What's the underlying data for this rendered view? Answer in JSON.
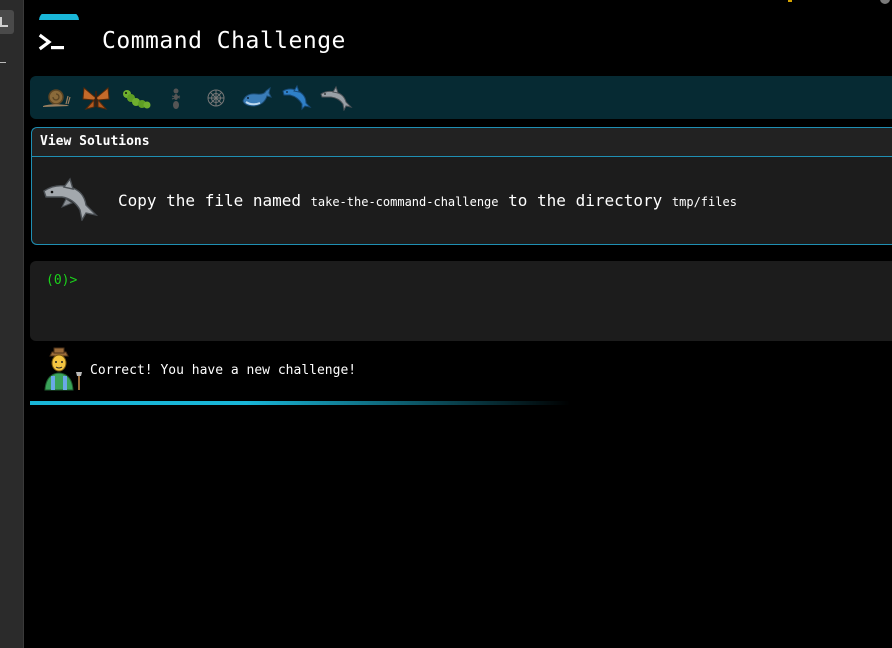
{
  "app": {
    "title": "Command Challenge"
  },
  "levels": [
    {
      "name": "snail-icon"
    },
    {
      "name": "butterfly-icon"
    },
    {
      "name": "caterpillar-icon"
    },
    {
      "name": "ant-icon"
    },
    {
      "name": "spider-web-icon"
    },
    {
      "name": "whale-icon"
    },
    {
      "name": "dolphin-icon"
    },
    {
      "name": "dolphin-gray-icon"
    }
  ],
  "solutions": {
    "header": "View Solutions",
    "text_before": "Copy the file named ",
    "file_name": "take-the-command-challenge",
    "text_middle": " to the directory ",
    "directory": "tmp/files"
  },
  "terminal": {
    "prompt": "(0)>"
  },
  "feedback": {
    "message": "Correct! You have a new challenge!"
  },
  "colors": {
    "accent": "#19b6d8",
    "prompt": "#1bd31b",
    "level_bar": "#062a33",
    "panel_border": "#1f8fb3"
  }
}
